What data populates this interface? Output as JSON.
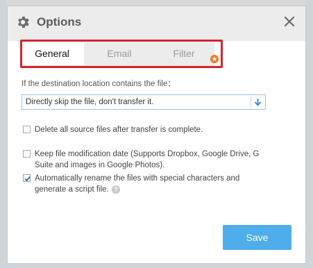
{
  "dialog": {
    "title": "Options",
    "icons": {
      "title": "gear-icon",
      "close": "close-icon"
    }
  },
  "tabs": [
    {
      "label": "General",
      "active": true
    },
    {
      "label": "Email",
      "active": false
    },
    {
      "label": "Filter",
      "active": false,
      "badge_icon": "star-badge-icon"
    }
  ],
  "general": {
    "conflict_label": "If the destination location contains the file：",
    "conflict_select": {
      "value": "Directly skip the file, don't transfer it.",
      "icon": "arrow-down-icon"
    },
    "options": [
      {
        "text": "Delete all source files after transfer is complete.",
        "checked": false
      },
      {
        "text": "Keep file modification date (Supports Dropbox, Google Drive, G Suite and images in Google Photos).",
        "checked": false
      },
      {
        "text": "Automatically rename the files with special characters and generate a script file.",
        "checked": true,
        "help_icon": "question-icon"
      }
    ]
  },
  "footer": {
    "save_label": "Save"
  },
  "colors": {
    "accent": "#4eadea",
    "highlight": "#d4232c",
    "badge": "#f07a22"
  }
}
